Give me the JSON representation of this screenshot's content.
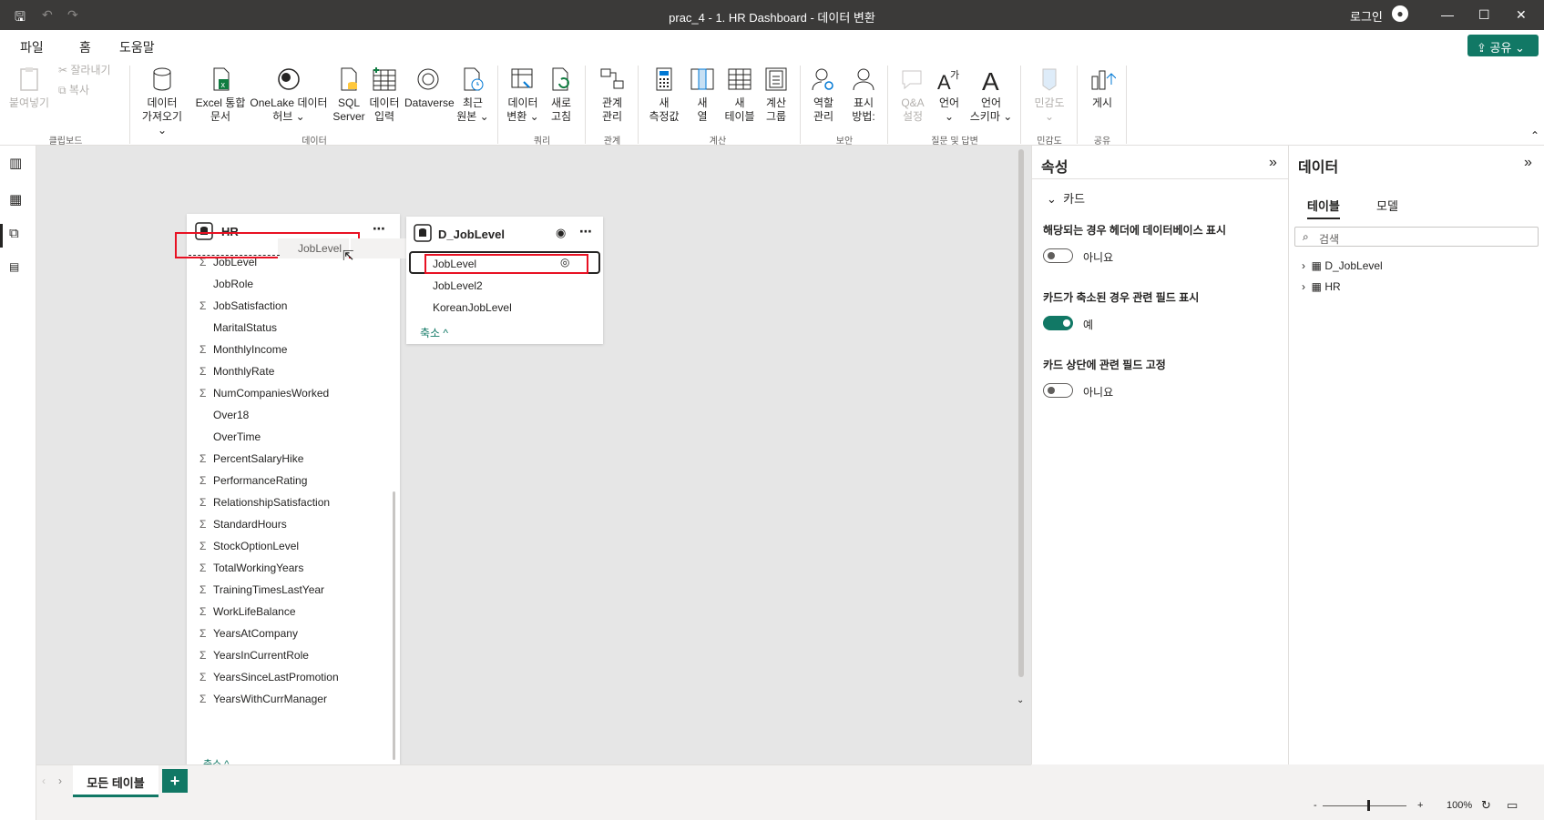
{
  "title": {
    "text": "prac_4 - 1. HR Dashboard - 데이터 변환",
    "login": "로그인"
  },
  "menu": {
    "file": "파일",
    "home": "홈",
    "help": "도움말",
    "share": "공유"
  },
  "ribbon": {
    "paste": "붙여넣기",
    "cut": "잘라내기",
    "copy": "복사",
    "clipboard": "클립보드",
    "getdata1": "데이터",
    "getdata2": "가져오기",
    "excel1": "Excel 통합",
    "excel2": "문서",
    "onelake1": "OneLake 데이터",
    "onelake2": "허브",
    "sql1": "SQL",
    "sql2": "Server",
    "enter1": "데이터",
    "enter2": "입력",
    "dataverse": "Dataverse",
    "recent1": "최근",
    "recent2": "원본",
    "data_group": "데이터",
    "transform1": "데이터",
    "transform2": "변환",
    "refresh1": "새로",
    "refresh2": "고침",
    "query_group": "쿼리",
    "manage1": "관계",
    "manage2": "관리",
    "rel_group": "관계",
    "newmeasure1": "새",
    "newmeasure2": "측정값",
    "newcol1": "새",
    "newcol2": "열",
    "newtable1": "새",
    "newtable2": "테이블",
    "calcgroup1": "계산",
    "calcgroup2": "그룹",
    "calc_group": "계산",
    "roles1": "역할",
    "roles2": "관리",
    "viewas1": "표시",
    "viewas2": "방법:",
    "security_group": "보안",
    "qa1": "Q&A",
    "qa2": "설정",
    "lang": "언어",
    "schema1": "언어",
    "schema2": "스키마",
    "qa_group": "질문 및 답변",
    "sens": "민감도",
    "sens_group": "민감도",
    "publish": "게시",
    "share_group": "공유"
  },
  "hr_card": {
    "title": "HR",
    "fields": [
      {
        "name": "JobLevel",
        "sum": "Σ"
      },
      {
        "name": "JobRole",
        "sum": ""
      },
      {
        "name": "JobSatisfaction",
        "sum": "Σ"
      },
      {
        "name": "MaritalStatus",
        "sum": ""
      },
      {
        "name": "MonthlyIncome",
        "sum": "Σ"
      },
      {
        "name": "MonthlyRate",
        "sum": "Σ"
      },
      {
        "name": "NumCompaniesWorked",
        "sum": "Σ"
      },
      {
        "name": "Over18",
        "sum": ""
      },
      {
        "name": "OverTime",
        "sum": ""
      },
      {
        "name": "PercentSalaryHike",
        "sum": "Σ"
      },
      {
        "name": "PerformanceRating",
        "sum": "Σ"
      },
      {
        "name": "RelationshipSatisfaction",
        "sum": "Σ"
      },
      {
        "name": "StandardHours",
        "sum": "Σ"
      },
      {
        "name": "StockOptionLevel",
        "sum": "Σ"
      },
      {
        "name": "TotalWorkingYears",
        "sum": "Σ"
      },
      {
        "name": "TrainingTimesLastYear",
        "sum": "Σ"
      },
      {
        "name": "WorkLifeBalance",
        "sum": "Σ"
      },
      {
        "name": "YearsAtCompany",
        "sum": "Σ"
      },
      {
        "name": "YearsInCurrentRole",
        "sum": "Σ"
      },
      {
        "name": "YearsSinceLastPromotion",
        "sum": "Σ"
      },
      {
        "name": "YearsWithCurrManager",
        "sum": "Σ"
      }
    ],
    "collapse": "축소 ^",
    "drag_ghost": "JobLevel"
  },
  "d_card": {
    "title": "D_JobLevel",
    "fields": [
      "JobLevel",
      "JobLevel2",
      "KoreanJobLevel"
    ],
    "collapse": "축소 ^"
  },
  "properties": {
    "title": "속성",
    "section": "카드",
    "opt1": "해당되는 경우 헤더에 데이터베이스 표시",
    "opt1_val": "아니요",
    "opt2": "카드가 축소된 경우 관련 필드 표시",
    "opt2_val": "예",
    "opt3": "카드 상단에 관련 필드 고정",
    "opt3_val": "아니요"
  },
  "data_pane": {
    "title": "데이터",
    "tab_tables": "테이블",
    "tab_model": "모델",
    "search_placeholder": "검색",
    "tables": [
      "D_JobLevel",
      "HR"
    ]
  },
  "bottom": {
    "tab": "모든 테이블",
    "add": "+",
    "zoom": "100%"
  },
  "colors": {
    "accent": "#117865",
    "highlight": "#e81123",
    "titlebar": "#3b3a39"
  }
}
